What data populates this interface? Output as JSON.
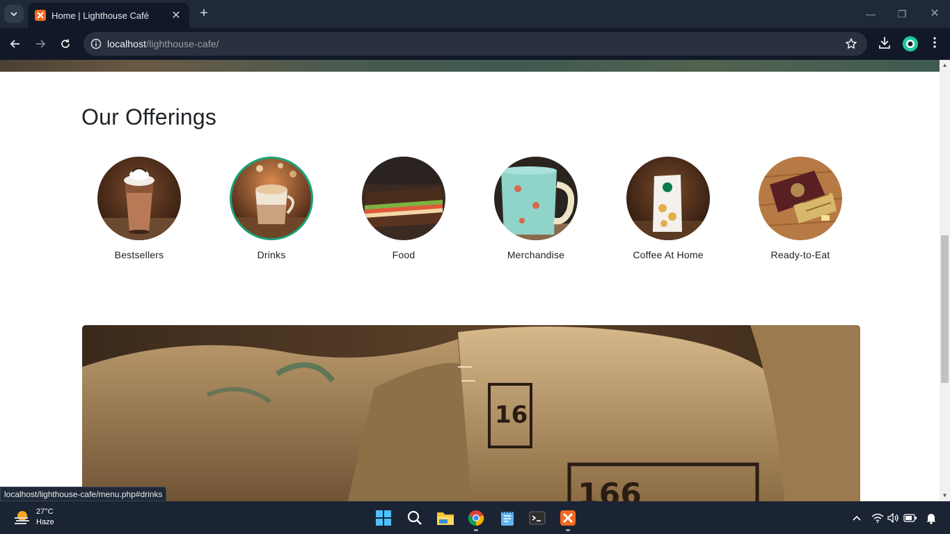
{
  "browser": {
    "tab_title": "Home | Lighthouse Café",
    "url_host": "localhost",
    "url_path": "/lighthouse-cafe/",
    "status_url": "localhost/lighthouse-cafe/menu.php#drinks"
  },
  "page": {
    "section_title": "Our Offerings",
    "offerings": [
      {
        "label": "Bestsellers",
        "active": false
      },
      {
        "label": "Drinks",
        "active": true
      },
      {
        "label": "Food",
        "active": false
      },
      {
        "label": "Merchandise",
        "active": false
      },
      {
        "label": "Coffee At Home",
        "active": false
      },
      {
        "label": "Ready-to-Eat",
        "active": false
      }
    ],
    "accent_color": "#1aa077"
  },
  "taskbar": {
    "temperature": "27°C",
    "condition": "Haze"
  }
}
